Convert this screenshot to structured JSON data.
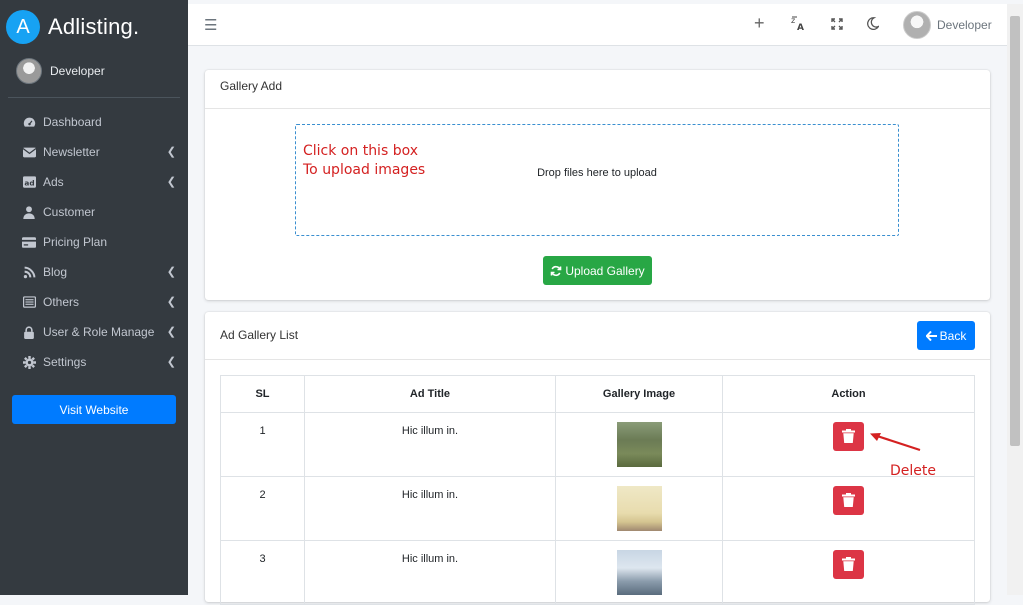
{
  "brand": {
    "logo_letter": "A",
    "name": "Adlisting."
  },
  "sidebar": {
    "user_name": "Developer",
    "items": [
      {
        "label": "Dashboard",
        "icon": "dashboard-icon",
        "has_submenu": false
      },
      {
        "label": "Newsletter",
        "icon": "envelope-icon",
        "has_submenu": true
      },
      {
        "label": "Ads",
        "icon": "ad-icon",
        "has_submenu": true
      },
      {
        "label": "Customer",
        "icon": "user-icon",
        "has_submenu": false
      },
      {
        "label": "Pricing Plan",
        "icon": "credit-card-icon",
        "has_submenu": false
      },
      {
        "label": "Blog",
        "icon": "blog-icon",
        "has_submenu": true
      },
      {
        "label": "Others",
        "icon": "list-icon",
        "has_submenu": true
      },
      {
        "label": "User & Role Manage",
        "icon": "lock-icon",
        "has_submenu": true
      },
      {
        "label": "Settings",
        "icon": "gear-icon",
        "has_submenu": true
      }
    ],
    "visit_website": "Visit Website"
  },
  "topbar": {
    "user_name": "Developer"
  },
  "gallery_add": {
    "title": "Gallery Add",
    "dropzone_text": "Drop files here to upload",
    "upload_button": "Upload Gallery"
  },
  "annotations": {
    "line1": "Click on this box",
    "line2": "To upload images",
    "delete": "Delete"
  },
  "gallery_list": {
    "title": "Ad Gallery List",
    "back_button": "Back",
    "columns": [
      "SL",
      "Ad Title",
      "Gallery Image",
      "Action"
    ],
    "rows": [
      {
        "sl": "1",
        "title": "Hic illum in."
      },
      {
        "sl": "2",
        "title": "Hic illum in."
      },
      {
        "sl": "3",
        "title": "Hic illum in."
      }
    ]
  },
  "colors": {
    "sidebar": "#343a40",
    "primary": "#007bff",
    "success": "#28a745",
    "danger": "#dc3545",
    "annotation": "#d42121"
  }
}
